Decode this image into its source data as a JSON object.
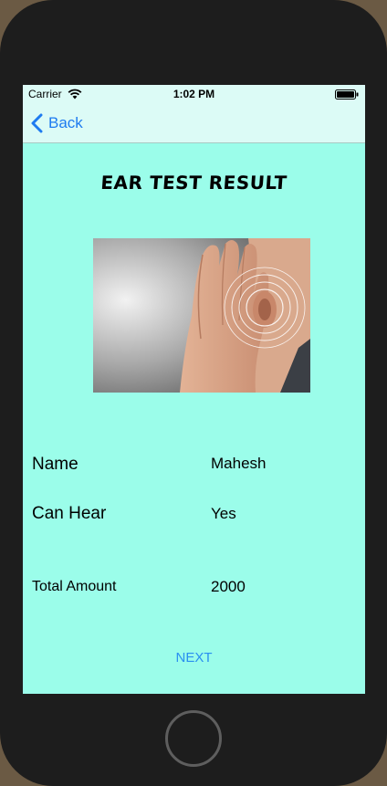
{
  "status_bar": {
    "carrier": "Carrier",
    "time": "1:02 PM"
  },
  "nav": {
    "back_label": "Back"
  },
  "page": {
    "title": "EAR TEST RESULT"
  },
  "result": {
    "name_label": "Name",
    "name_value": "Mahesh",
    "can_hear_label": "Can Hear",
    "can_hear_value": "Yes",
    "total_label": "Total Amount",
    "total_value": "2000"
  },
  "actions": {
    "next_label": "NEXT"
  },
  "colors": {
    "screen_bg": "#9bfdea",
    "nav_bg": "#dcfbf6",
    "accent": "#1e7bf0",
    "device": "#1d1d1d"
  },
  "icons": {
    "back": "chevron-left-icon",
    "wifi": "wifi-icon",
    "battery": "battery-icon",
    "home": "home-button"
  }
}
